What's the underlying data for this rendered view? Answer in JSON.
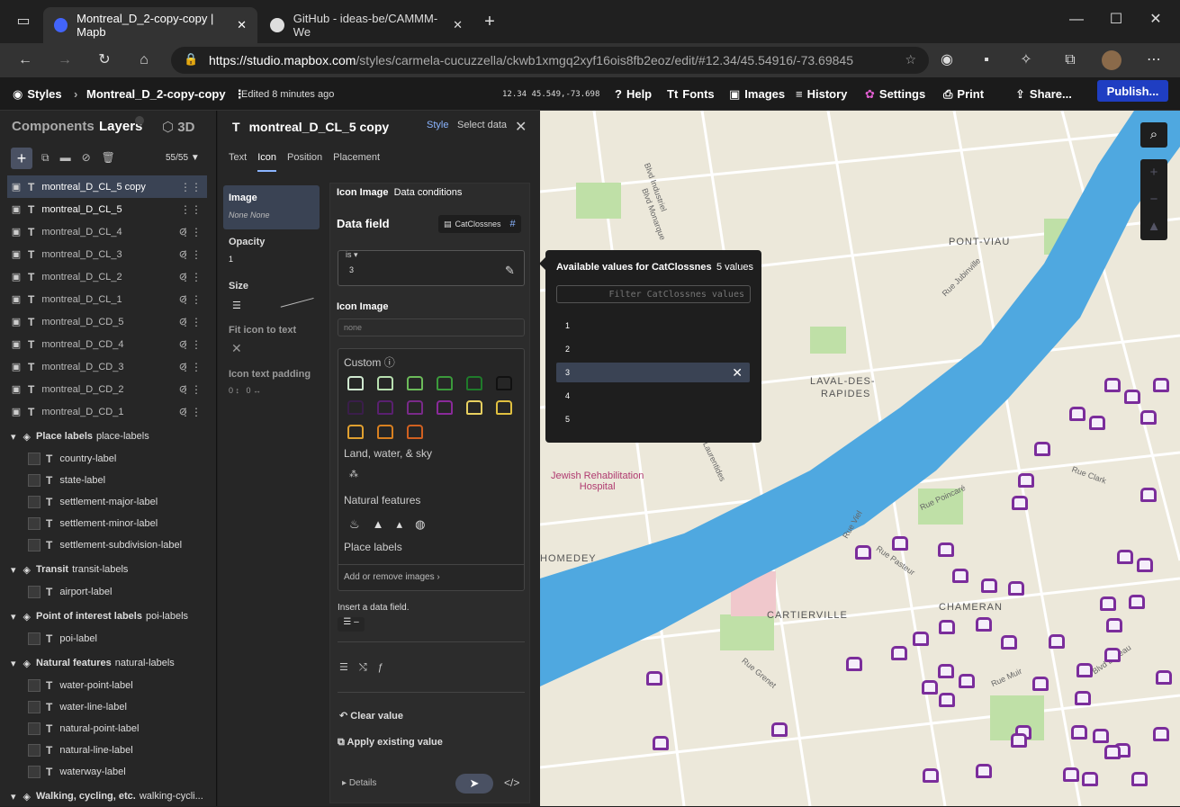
{
  "browser": {
    "tab1": "Montreal_D_2-copy-copy | Mapb",
    "tab2": "GitHub - ideas-be/CAMMM-We",
    "url_host": "https://studio.mapbox.com",
    "url_path": "/styles/carmela-cucuzzella/ckwb1xmgq2xyf16ois8fb2eoz/edit/#12.34/45.54916/-73.69845"
  },
  "topbar": {
    "styles": "Styles",
    "style_name": "Montreal_D_2-copy-copy",
    "edited": "Edited 8 minutes ago",
    "coords": "12.34 45.549,-73.698",
    "help": "Help",
    "fonts": "Fonts",
    "images": "Images",
    "history": "History",
    "settings": "Settings",
    "print": "Print",
    "share": "Share...",
    "publish": "Publish..."
  },
  "left": {
    "components": "Components",
    "layers": "Layers",
    "three_d": "3D",
    "count": "55/55",
    "layers_list": [
      "montreal_D_CL_5 copy",
      "montreal_D_CL_5",
      "montreal_D_CL_4",
      "montreal_D_CL_3",
      "montreal_D_CL_2",
      "montreal_D_CL_1",
      "montreal_D_CD_5",
      "montreal_D_CD_4",
      "montreal_D_CD_3",
      "montreal_D_CD_2",
      "montreal_D_CD_1"
    ],
    "groups": [
      {
        "title": "Place labels",
        "sub": "place-labels",
        "items": [
          "country-label",
          "state-label",
          "settlement-major-label",
          "settlement-minor-label",
          "settlement-subdivision-label"
        ]
      },
      {
        "title": "Transit",
        "sub": "transit-labels",
        "items": [
          "airport-label"
        ]
      },
      {
        "title": "Point of interest labels",
        "sub": "poi-labels",
        "items": [
          "poi-label"
        ]
      },
      {
        "title": "Natural features",
        "sub": "natural-labels",
        "items": [
          "water-point-label",
          "water-line-label",
          "natural-point-label",
          "natural-line-label",
          "waterway-label"
        ]
      },
      {
        "title": "Walking, cycling, etc.",
        "sub": "walking-cycli...",
        "items": []
      }
    ]
  },
  "editor": {
    "title": "montreal_D_CL_5 copy",
    "style": "Style",
    "select_data": "Select data",
    "tabs": [
      "Text",
      "Icon",
      "Position",
      "Placement"
    ],
    "props": {
      "image": "Image",
      "image_val": "None None",
      "opacity": "Opacity",
      "opacity_val": "1",
      "size": "Size",
      "fit": "Fit icon to text",
      "padding": "Icon text padding",
      "pad1": "0",
      "pad2": "0"
    },
    "icon_image": "Icon Image",
    "data_conditions": "Data conditions",
    "data_field": "Data field",
    "field_name": "CatClossnes",
    "is": "is",
    "is_val": "3",
    "icon_image2": "Icon Image",
    "none": "none",
    "custom": "Custom",
    "land": "Land, water, & sky",
    "natural": "Natural features",
    "place": "Place labels",
    "add_remove": "Add or remove images",
    "insert": "Insert a data field.",
    "clear": "Clear value",
    "apply": "Apply existing value",
    "details": "Details"
  },
  "popup": {
    "title": "Available values for CatClossnes",
    "count": "5 values",
    "filter_placeholder": "Filter CatClossnes values",
    "values": [
      "1",
      "2",
      "3",
      "4",
      "5"
    ]
  },
  "map_labels": {
    "pont_viau": "PONT-VIAU",
    "laval": "LAVAL-DES-",
    "rapides": "RAPIDES",
    "jewish1": "Jewish Rehabilitation",
    "jewish2": "Hospital",
    "homedey": "HOMEDEY",
    "cartierville": "CARTIERVILLE",
    "chameran": "CHAMERAN",
    "bd_ind": "Blvd Industriel",
    "bd_mon": "Blvd Monarque",
    "rue_jub": "Rue Jubinville",
    "bd_lebeau": "Blvd Lebeau",
    "rue_muir": "Rue Muir",
    "rue_grenet": "Rue Grenet",
    "rue_clark": "Rue Clark",
    "rue_poincare": "Rue Poincaré",
    "rue_pasteur": "Rue Pasteur",
    "rue_viel": "Rue Viel",
    "bd_laur": "Laurentides"
  }
}
